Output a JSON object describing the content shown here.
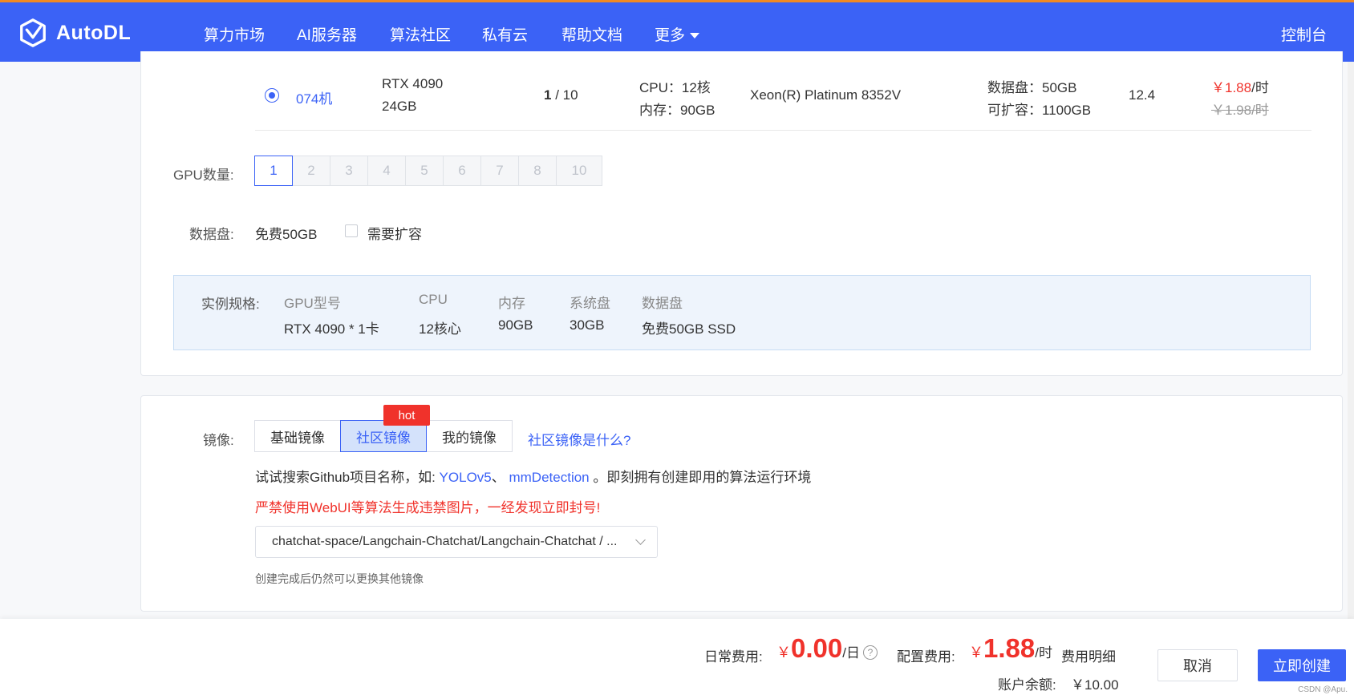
{
  "brand": {
    "name": "AutoDL"
  },
  "nav": {
    "items": [
      "算力市场",
      "AI服务器",
      "算法社区",
      "私有云",
      "帮助文档",
      "更多"
    ],
    "console": "控制台"
  },
  "machine_row": {
    "machine": "074机",
    "gpu_model": "RTX 4090",
    "gpu_mem": "24GB",
    "avail": "1",
    "total": " / 10",
    "cpu": "CPU：12核",
    "mem": "内存：90GB",
    "cpu_model": "Xeon(R) Platinum 8352V",
    "data_disk": "数据盘：50GB",
    "expandable": "可扩容：1100GB",
    "cuda": "12.4",
    "price": "￥1.88",
    "price_unit": "/时",
    "orig_price": "￥1.98/时"
  },
  "gpu_count": {
    "label": "GPU数量:",
    "options": [
      "1",
      "2",
      "3",
      "4",
      "5",
      "6",
      "7",
      "8",
      "10"
    ],
    "selected": "1"
  },
  "disk": {
    "label": "数据盘:",
    "free": "免费50GB",
    "expand_label": "需要扩容"
  },
  "spec": {
    "label": "实例规格:",
    "headers": [
      "GPU型号",
      "CPU",
      "内存",
      "系统盘",
      "数据盘"
    ],
    "values": [
      "RTX 4090 * 1卡",
      "12核心",
      "90GB",
      "30GB",
      "免费50GB SSD"
    ]
  },
  "image": {
    "label": "镜像:",
    "tabs": [
      "基础镜像",
      "社区镜像",
      "我的镜像"
    ],
    "active_tab": "社区镜像",
    "hot": "hot",
    "what_link": "社区镜像是什么?",
    "tip_prefix": "试试搜索Github项目名称，如:",
    "tip_link1": "YOLOv5",
    "tip_sep": "、",
    "tip_link2": "mmDetection",
    "tip_suffix": "。即刻拥有创建即用的算法运行环境",
    "warning": "严禁使用WebUI等算法生成违禁图片，一经发现立即封号!",
    "selected_value": "chatchat-space/Langchain-Chatchat/Langchain-Chatchat / ...",
    "hint": "创建完成后仍然可以更换其他镜像"
  },
  "footer": {
    "daily_label": "日常费用:",
    "daily_yen": "￥",
    "daily_value": "0.00",
    "daily_unit": "/日",
    "config_label": "配置费用:",
    "config_yen": "￥",
    "config_value": "1.88",
    "config_unit": "/时",
    "detail_link": "费用明细",
    "balance_label": "账户余额:",
    "balance_value": "￥10.00",
    "cancel": "取消",
    "create": "立即创建",
    "watermark": "CSDN @Apu."
  },
  "colors": {
    "primary": "#3b62f6",
    "danger": "#f0322b",
    "accent_line": "#f08a24"
  }
}
